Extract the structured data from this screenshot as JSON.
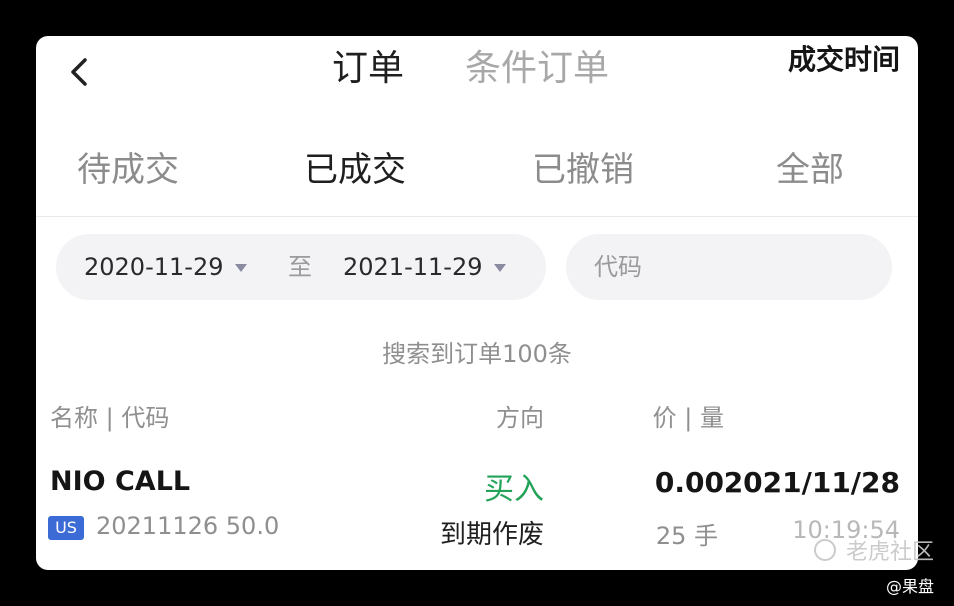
{
  "header": {
    "tabs": [
      {
        "label": "订单"
      },
      {
        "label": "条件订单"
      }
    ]
  },
  "filters": [
    {
      "label": "待成交"
    },
    {
      "label": "已成交"
    },
    {
      "label": "已撤销"
    },
    {
      "label": "全部"
    }
  ],
  "search": {
    "start_date": "2020-11-29",
    "to_text": "至",
    "end_date": "2021-11-29",
    "code_placeholder": "代码"
  },
  "summary": "搜索到订单100条",
  "columns": {
    "name_code": "名称 | 代码",
    "direction": "方向",
    "price_qty": "价 | 量",
    "fill_time": "成交时间"
  },
  "orders": [
    {
      "symbol": "NIO CALL",
      "market": "US",
      "contract": "20211126 50.0",
      "direction": "买入",
      "status": "到期作废",
      "price": "0.00",
      "quantity": "25 手",
      "date": "2021/11/28",
      "time": "10:19:54"
    }
  ],
  "overlay": {
    "watermark": "老虎社区",
    "credit": "@果盘"
  },
  "colors": {
    "buy_green": "#23a35a",
    "badge_blue": "#3c6bd6"
  },
  "icons": {
    "back": "back-arrow-icon",
    "caret": "caret-down-icon"
  }
}
